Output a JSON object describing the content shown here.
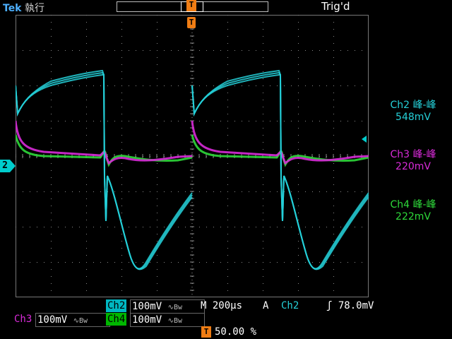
{
  "header": {
    "brand": "Tek",
    "run_state": "執行",
    "trigger_status": "Trig'd",
    "trigger_marker": "T"
  },
  "channel_marker": "2",
  "measurements": [
    {
      "label": "Ch2 峰-峰",
      "value": "548mV",
      "color": "#25d0d8"
    },
    {
      "label": "Ch3 峰-峰",
      "value": "220mV",
      "color": "#d92bd9"
    },
    {
      "label": "Ch4 峰-峰",
      "value": "222mV",
      "color": "#2ed93a"
    }
  ],
  "channels": {
    "ch2": {
      "name": "Ch2",
      "scale": "100mV",
      "bw_icon": "∿Bw"
    },
    "ch3": {
      "name": "Ch3",
      "scale": "100mV",
      "bw_icon": "∿Bw"
    },
    "ch4": {
      "name": "Ch4",
      "scale": "100mV",
      "bw_icon": "∿Bw"
    }
  },
  "timebase": {
    "label": "M",
    "scale": "200µs"
  },
  "trigger": {
    "mode": "A",
    "source": "Ch2",
    "slope_icon": "rising-edge",
    "slope_glyph": "ʃ",
    "level": "78.0mV",
    "position": "50.00 %"
  },
  "colors": {
    "ch2": "#25d0d8",
    "ch3": "#d92bd9",
    "ch4": "#2ed93a",
    "trigger": "#f07d14"
  }
}
